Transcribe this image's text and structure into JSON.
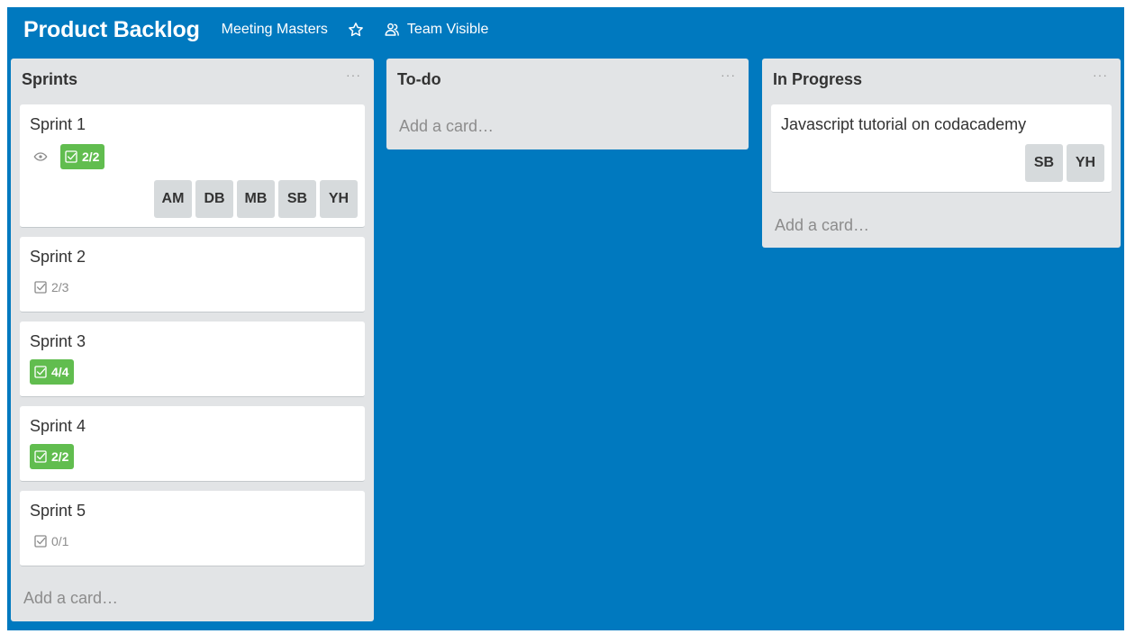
{
  "header": {
    "board_title": "Product Backlog",
    "team_name": "Meeting Masters",
    "star_icon": "star-icon",
    "visibility_icon": "team-icon",
    "visibility_label": "Team Visible"
  },
  "colors": {
    "board_background": "#0079bf",
    "list_background": "#e2e4e6",
    "badge_complete": "#61bd4f"
  },
  "lists": [
    {
      "title": "Sprints",
      "menu_label": "···",
      "add_card_label": "Add a card…",
      "cards": [
        {
          "title": "Sprint 1",
          "watching_icon": "eye-icon",
          "checklist": "2/2",
          "checklist_complete": true,
          "members": [
            "AM",
            "DB",
            "MB",
            "SB",
            "YH"
          ]
        },
        {
          "title": "Sprint 2",
          "checklist": "2/3",
          "checklist_complete": false
        },
        {
          "title": "Sprint 3",
          "checklist": "4/4",
          "checklist_complete": true
        },
        {
          "title": "Sprint 4",
          "checklist": "2/2",
          "checklist_complete": true
        },
        {
          "title": "Sprint 5",
          "checklist": "0/1",
          "checklist_complete": false
        }
      ]
    },
    {
      "title": "To-do",
      "menu_label": "···",
      "add_card_label": "Add a card…",
      "cards": []
    },
    {
      "title": "In Progress",
      "menu_label": "···",
      "add_card_label": "Add a card…",
      "cards": [
        {
          "title": "Javascript tutorial on codacademy",
          "members": [
            "SB",
            "YH"
          ]
        }
      ]
    }
  ]
}
